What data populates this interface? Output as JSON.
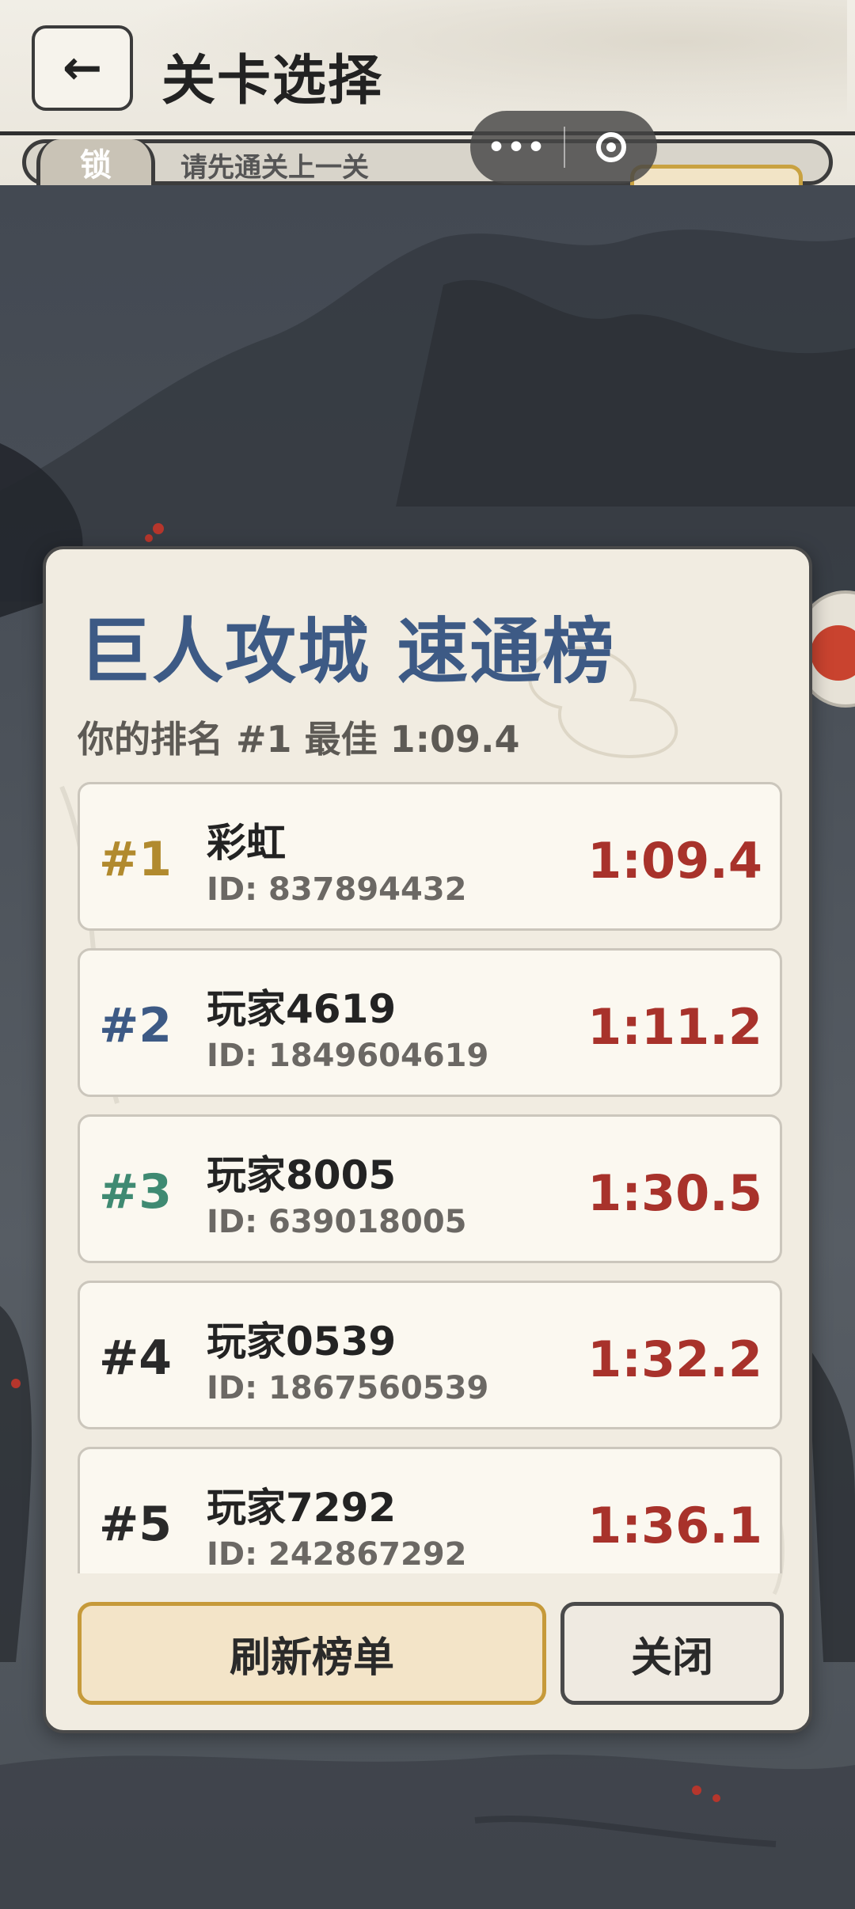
{
  "header": {
    "back_icon": "left-arrow-icon",
    "back_glyph": "←",
    "title": "关卡选择",
    "lock_label": "锁",
    "lock_hint": "请先通关上一关",
    "capsule_menu_glyph": "•••"
  },
  "leaderboard": {
    "title": "巨人攻城 速通榜",
    "summary": "你的排名 #1  最佳 1:09.4",
    "entries": [
      {
        "rank": "#1",
        "name": "彩虹",
        "id": "ID: 837894432",
        "time": "1:09.4",
        "rank_color": "#b18a2e"
      },
      {
        "rank": "#2",
        "name": "玩家4619",
        "id": "ID: 1849604619",
        "time": "1:11.2",
        "rank_color": "#3d5a85"
      },
      {
        "rank": "#3",
        "name": "玩家8005",
        "id": "ID: 639018005",
        "time": "1:30.5",
        "rank_color": "#3f8a72"
      },
      {
        "rank": "#4",
        "name": "玩家0539",
        "id": "ID: 1867560539",
        "time": "1:32.2",
        "rank_color": "#2a2a2a"
      },
      {
        "rank": "#5",
        "name": "玩家7292",
        "id": "ID: 242867292",
        "time": "1:36.1",
        "rank_color": "#2a2a2a"
      }
    ],
    "refresh_label": "刷新榜单",
    "close_label": "关闭"
  },
  "colors": {
    "title_blue": "#3d5a85",
    "time_red": "#a8322b",
    "gold_border": "#c69a3a"
  }
}
